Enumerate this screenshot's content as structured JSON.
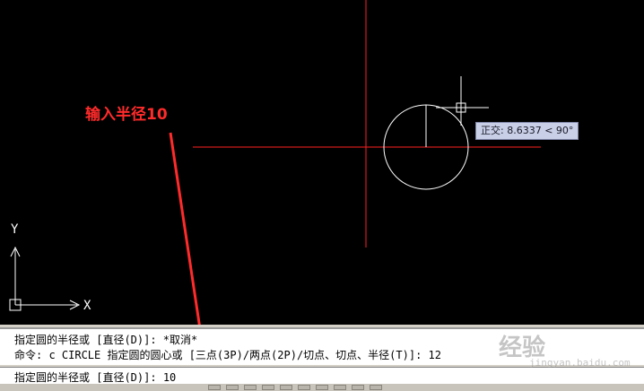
{
  "annotation": {
    "text": "输入半径10"
  },
  "tooltip": {
    "text": "正交: 8.6337 < 90°"
  },
  "ucs": {
    "x_label": "X",
    "y_label": "Y"
  },
  "command": {
    "history": [
      "指定圆的半径或 [直径(D)]: *取消*",
      "命令: c CIRCLE 指定圆的圆心或 [三点(3P)/两点(2P)/切点、切点、半径(T)]: 12"
    ],
    "prompt": "指定圆的半径或 [直径(D)]: ",
    "input_value": "10"
  },
  "watermark": {
    "text": "经验",
    "sub": "jingyan.baidu.com"
  },
  "colors": {
    "crosshair": "#ff1f1f",
    "entity": "#ffffff",
    "annotation": "#ff2b2b",
    "tooltip_bg": "#c9cfe6"
  }
}
